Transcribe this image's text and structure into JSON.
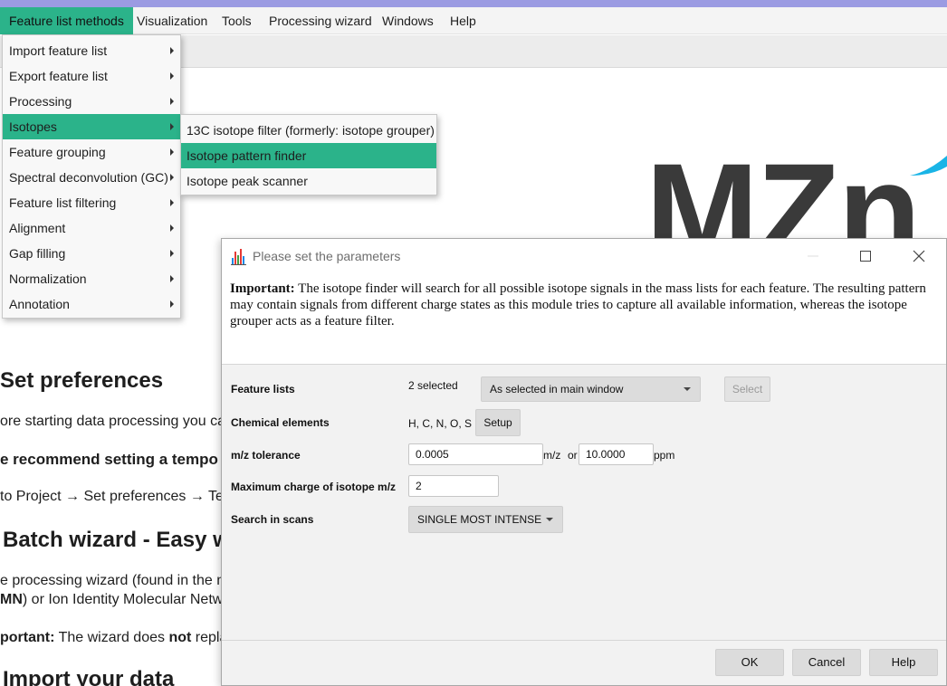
{
  "menubar": {
    "items": [
      {
        "label": "Feature list methods",
        "active": true
      },
      {
        "label": "Visualization"
      },
      {
        "label": "Tools"
      },
      {
        "label": "Processing wizard"
      },
      {
        "label": "Windows"
      },
      {
        "label": "Help"
      }
    ]
  },
  "dropdown": {
    "items": [
      {
        "label": "Import feature list"
      },
      {
        "label": "Export feature list"
      },
      {
        "label": "Processing"
      },
      {
        "label": "Isotopes",
        "active": true
      },
      {
        "label": "Feature grouping"
      },
      {
        "label": "Spectral deconvolution (GC)"
      },
      {
        "label": "Feature list filtering"
      },
      {
        "label": "Alignment"
      },
      {
        "label": "Gap filling"
      },
      {
        "label": "Normalization"
      },
      {
        "label": "Annotation"
      }
    ]
  },
  "submenu": {
    "items": [
      {
        "label": "13C isotope filter (formerly: isotope grouper)"
      },
      {
        "label": "Isotope pattern finder",
        "active": true
      },
      {
        "label": "Isotope peak scanner"
      }
    ]
  },
  "background_doc": {
    "logo_text": "MZn",
    "h_set_preferences": "Set preferences",
    "p_before": "ore starting data processing you ca",
    "b_recommend": "e recommend setting a tempo",
    "p_goto": "to Project → Set preferences → Te",
    "h_batch": "Batch wizard - Easy wo",
    "p_wizard": "e processing wizard (found in the m",
    "p_gnps_bold": "MN",
    "p_gnps_rest": ") or Ion Identity Molecular Netw",
    "p_important_bold": "portant:",
    "p_important_a": " The wizard does ",
    "p_important_not": "not",
    "p_important_b": " replac",
    "h_import": "Import your data"
  },
  "dialog": {
    "title": "Please set the parameters",
    "info_bold": "Important:",
    "info_text": " The isotope finder will search for all possible isotope signals in the mass lists for each feature. The resulting pattern may contain signals from different charge states as this module tries to capture all available information, whereas the isotope grouper acts as a feature filter.",
    "params": {
      "feature_lists": {
        "label": "Feature lists",
        "count": "2 selected",
        "combo": "As selected in main window",
        "button": "Select"
      },
      "chemical_elements": {
        "label": "Chemical elements",
        "value": "H, C, N, O, S",
        "button": "Setup"
      },
      "mz_tolerance": {
        "label": "m/z tolerance",
        "mz_value": "0.0005",
        "mz_unit": "m/z",
        "or": "or",
        "ppm_value": "10.0000",
        "ppm_unit": "ppm"
      },
      "max_charge": {
        "label": "Maximum charge of isotope m/z",
        "value": "2"
      },
      "search_scans": {
        "label": "Search in scans",
        "combo": "SINGLE MOST INTENSE"
      }
    },
    "buttons": {
      "ok": "OK",
      "cancel": "Cancel",
      "help": "Help"
    }
  },
  "colors": {
    "accent": "#2bb38a",
    "strip": "#9b9be2",
    "logo_swoosh": "#19b4e6"
  },
  "icons": [
    "submenu-arrow-icon",
    "minimize-icon",
    "maximize-icon",
    "close-icon",
    "app-chart-icon",
    "dropdown-arrow-icon"
  ]
}
